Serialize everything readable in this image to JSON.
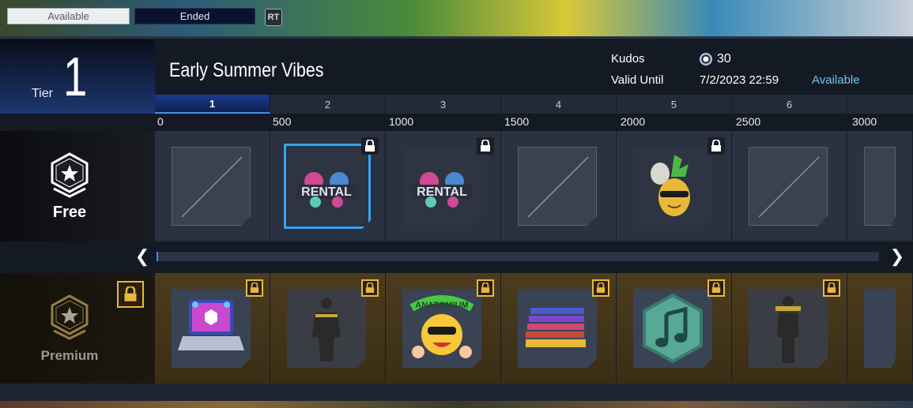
{
  "tabs": {
    "available": "Available",
    "ended": "Ended",
    "rt_badge": "RT"
  },
  "tier": {
    "label": "Tier",
    "number": "1"
  },
  "season": {
    "title": "Early Summer Vibes"
  },
  "info": {
    "kudos_label": "Kudos",
    "kudos_value": "30",
    "valid_until_label": "Valid Until",
    "valid_until_value": "7/2/2023 22:59",
    "status": "Available"
  },
  "levels": [
    "1",
    "2",
    "3",
    "4",
    "5",
    "6"
  ],
  "points": [
    "0",
    "500",
    "1000",
    "1500",
    "2000",
    "2500",
    "3000"
  ],
  "tracks": {
    "free_label": "Free",
    "premium_label": "Premium"
  },
  "free_rewards": [
    {
      "icon": "empty-slot-icon",
      "locked": false,
      "selected": false
    },
    {
      "icon": "rental-icon",
      "text": "RENTAL",
      "locked": true,
      "selected": true
    },
    {
      "icon": "rental-icon",
      "text": "RENTAL",
      "locked": true,
      "selected": false
    },
    {
      "icon": "empty-slot-icon",
      "locked": false,
      "selected": false
    },
    {
      "icon": "pineapple-avatar-icon",
      "locked": true,
      "selected": false
    },
    {
      "icon": "empty-slot-icon",
      "locked": false,
      "selected": false
    }
  ],
  "premium_rewards": [
    {
      "icon": "laptop-icon",
      "locked": true
    },
    {
      "icon": "outfit-icon",
      "locked": true
    },
    {
      "icon": "sunflower-sticker-icon",
      "text": "ANATOMIUM",
      "locked": true
    },
    {
      "icon": "book-stack-icon",
      "locked": true
    },
    {
      "icon": "music-note-icon",
      "locked": true
    },
    {
      "icon": "outfit-icon",
      "locked": true
    }
  ],
  "progress": {
    "value": 0.0
  },
  "colors": {
    "accent_blue": "#36a4f0",
    "status_available": "#6ec6f2",
    "premium_gold": "#e8b840"
  }
}
